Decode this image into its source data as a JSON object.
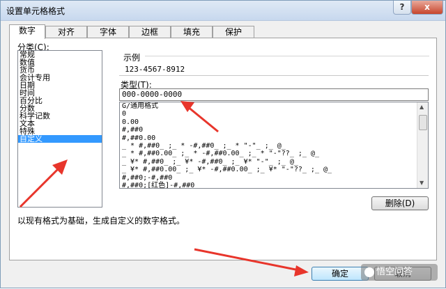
{
  "window": {
    "title": "设置单元格格式",
    "help_label": "?",
    "close_label": "x"
  },
  "tabs": [
    {
      "label": "数字",
      "active": true
    },
    {
      "label": "对齐"
    },
    {
      "label": "字体"
    },
    {
      "label": "边框"
    },
    {
      "label": "填充"
    },
    {
      "label": "保护"
    }
  ],
  "category": {
    "label": "分类(C):",
    "items": [
      "常规",
      "数值",
      "货币",
      "会计专用",
      "日期",
      "时间",
      "百分比",
      "分数",
      "科学记数",
      "文本",
      "特殊",
      "自定义"
    ],
    "selected": "自定义"
  },
  "sample": {
    "label": "示例",
    "value": "123-4567-8912"
  },
  "type": {
    "label": "类型(T):",
    "input_value": "000-0000-0000",
    "formats": [
      "G/通用格式",
      "0",
      "0.00",
      "#,##0",
      "#,##0.00",
      "_ * #,##0_ ;_ * -#,##0_ ;_ * \"-\"_ ;_ @_",
      "_ * #,##0.00_ ;_ * -#,##0.00_ ;_ * \"-\"??_ ;_ @_",
      "_ ¥* #,##0_ ;_ ¥* -#,##0_ ;_ ¥* \"-\"_ ;_ @_",
      "_ ¥* #,##0.00_ ;_ ¥* -#,##0.00_ ;_ ¥* \"-\"??_ ;_ @_",
      "#,##0;-#,##0",
      "#,##0;[红色]-#,##0"
    ]
  },
  "buttons": {
    "delete": "删除(D)",
    "ok": "确定",
    "cancel": "取消"
  },
  "description": "以现有格式为基础，生成自定义的数字格式。",
  "watermark": "悟空问答",
  "colors": {
    "selection": "#3399ff",
    "arrow": "#e8352b",
    "close": "#c7452c"
  }
}
